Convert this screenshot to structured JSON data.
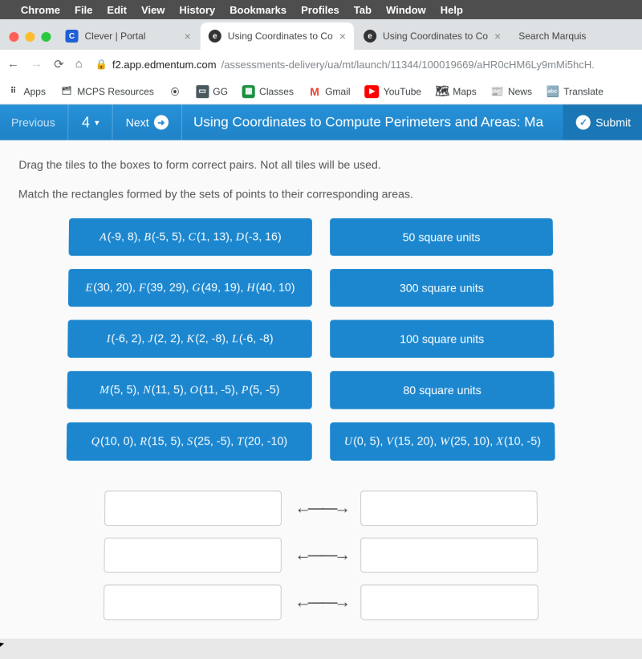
{
  "menubar": {
    "items": [
      "Chrome",
      "File",
      "Edit",
      "View",
      "History",
      "Bookmarks",
      "Profiles",
      "Tab",
      "Window",
      "Help"
    ]
  },
  "tabs": [
    {
      "label": "Clever | Portal",
      "favicon": "C"
    },
    {
      "label": "Using Coordinates to Co",
      "favicon": "e"
    },
    {
      "label": "Using Coordinates to Co",
      "favicon": "e"
    },
    {
      "label": "Search Marquis",
      "favicon": ""
    }
  ],
  "url": {
    "domain": "f2.app.edmentum.com",
    "path": "/assessments-delivery/ua/mt/launch/11344/100019669/aHR0cHM6Ly9mMi5hcH."
  },
  "bookmarks": [
    {
      "label": "Apps",
      "icon": "⠿"
    },
    {
      "label": "MCPS Resources",
      "icon": "🗂"
    },
    {
      "label": "",
      "icon": "⦿"
    },
    {
      "label": "GG",
      "icon": "GG"
    },
    {
      "label": "Classes",
      "icon": "▦"
    },
    {
      "label": "Gmail",
      "icon": "M"
    },
    {
      "label": "YouTube",
      "icon": "▶"
    },
    {
      "label": "Maps",
      "icon": "🗺"
    },
    {
      "label": "News",
      "icon": "📰"
    },
    {
      "label": "Translate",
      "icon": "🔤"
    }
  ],
  "header": {
    "previous": "Previous",
    "question_number": "4",
    "next": "Next",
    "title": "Using Coordinates to Compute Perimeters and Areas: Ma",
    "submit": "Submit"
  },
  "instructions": {
    "line1": "Drag the tiles to the boxes to form correct pairs. Not all tiles will be used.",
    "line2": "Match the rectangles formed by the sets of points to their corresponding areas."
  },
  "tiles_left": [
    "A(-9, 8), B(-5, 5), C(1, 13), D(-3, 16)",
    "E(30, 20), F(39, 29), G(49, 19), H(40, 10)",
    "I(-6, 2), J(2, 2), K(2, -8), L(-6, -8)",
    "M(5, 5), N(11, 5), O(11, -5), P(5, -5)",
    "Q(10, 0), R(15, 5), S(25, -5), T(20, -10)"
  ],
  "tiles_right": [
    "50 square units",
    "300 square units",
    "100 square units",
    "80 square units",
    "U(0, 5), V(15, 20), W(25, 10), X(10, -5)"
  ]
}
